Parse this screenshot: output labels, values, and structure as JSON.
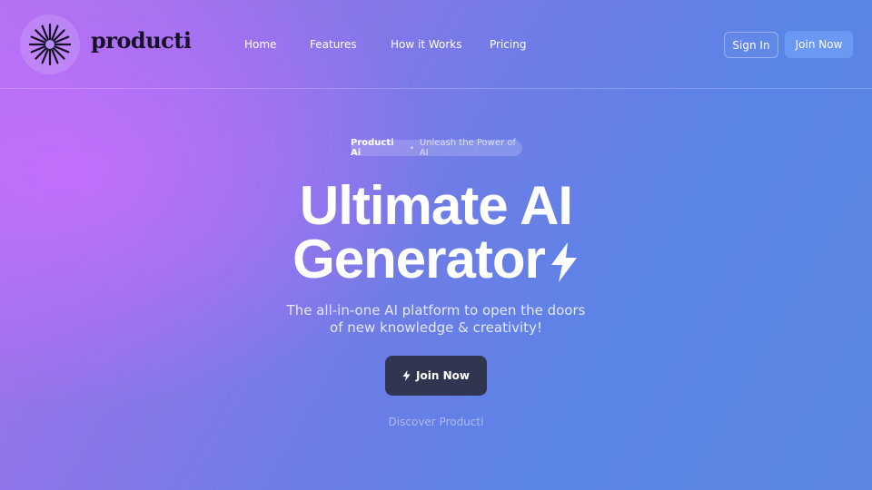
{
  "brand": {
    "name": "producti",
    "trademark": "™"
  },
  "nav": {
    "items": [
      "Home",
      "Features",
      "How it Works",
      "Pricing"
    ]
  },
  "actions": {
    "sign_in": "Sign In",
    "join_now": "Join Now"
  },
  "hero": {
    "badge_brand": "Producti Ai",
    "badge_tagline": "Unleash the Power of AI",
    "headline_line1": "Ultimate AI",
    "headline_line2": "Generator",
    "subtitle_line1": "The all-in-one AI platform to open the doors",
    "subtitle_line2": "of new knowledge & creativity!",
    "cta_label": "Join Now",
    "discover_label": "Discover Producti"
  },
  "icons": {
    "logo": "sunburst-icon",
    "headline_bolt": "lightning-bolt-icon",
    "cta_bolt": "lightning-bolt-icon"
  },
  "colors": {
    "cta_bg": "#30364f",
    "text": "#ffffff",
    "logo_ink": "#151127"
  }
}
